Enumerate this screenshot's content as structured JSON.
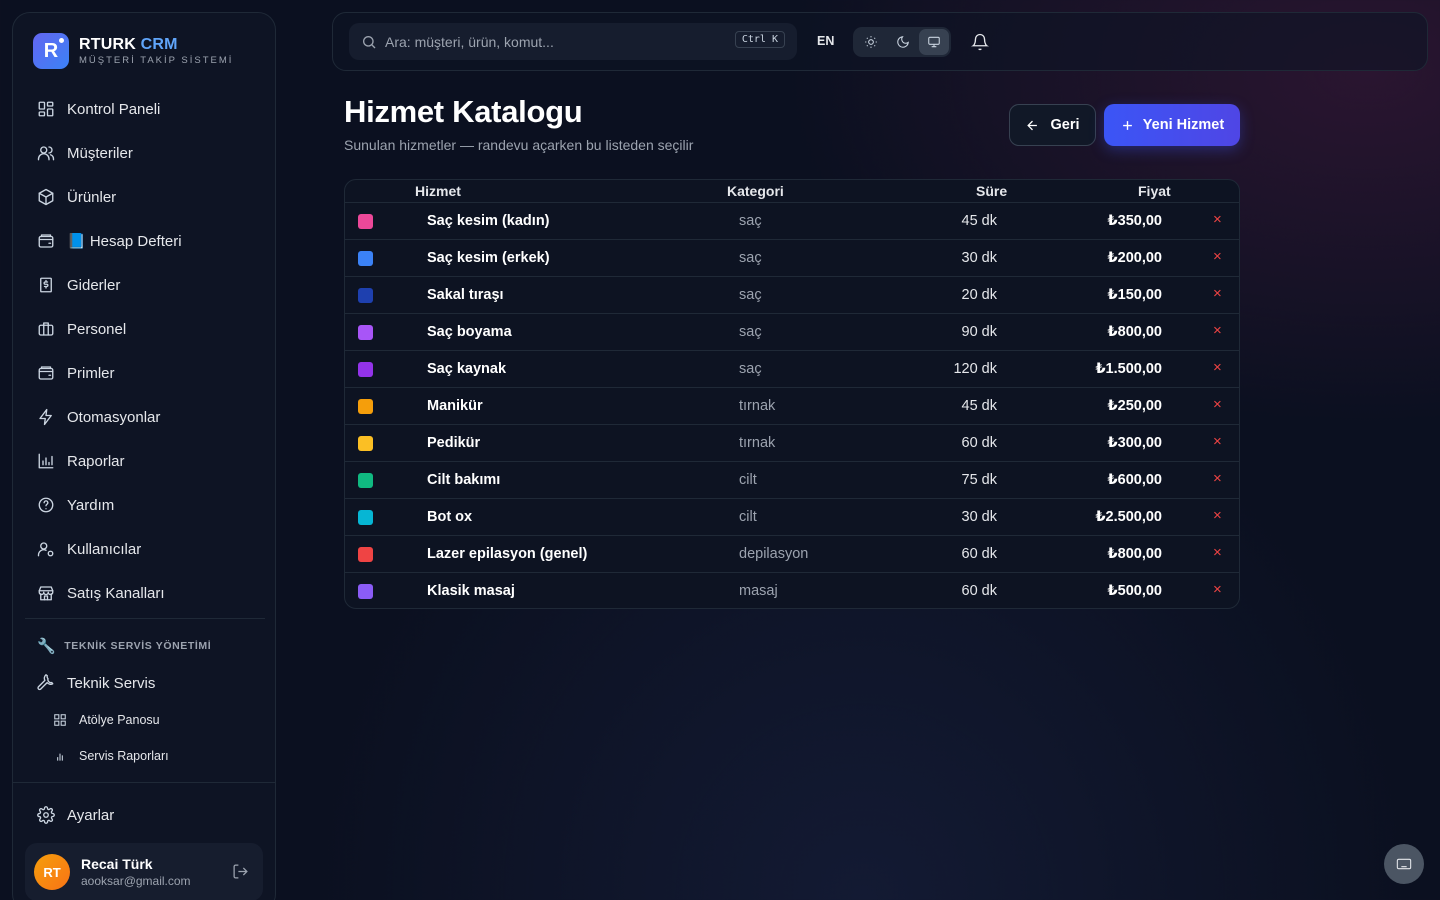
{
  "brand": {
    "name_main": "RTURK",
    "name_accent": "CRM",
    "subtitle": "MÜŞTERİ TAKİP SİSTEMİ",
    "logo_letter": "R"
  },
  "sidebar": {
    "items": [
      {
        "label": "Kontrol Paneli",
        "icon": "dashboard-icon"
      },
      {
        "label": "Müşteriler",
        "icon": "users-icon"
      },
      {
        "label": "Ürünler",
        "icon": "package-icon"
      },
      {
        "label": "📘 Hesap Defteri",
        "icon": "wallet-icon"
      },
      {
        "label": "Giderler",
        "icon": "receipt-icon"
      },
      {
        "label": "Personel",
        "icon": "briefcase-icon"
      },
      {
        "label": "Primler",
        "icon": "wallet-icon"
      },
      {
        "label": "Otomasyonlar",
        "icon": "bolt-icon"
      },
      {
        "label": "Raporlar",
        "icon": "bar-chart-icon"
      },
      {
        "label": "Yardım",
        "icon": "help-circle-icon"
      },
      {
        "label": "Kullanıcılar",
        "icon": "user-cog-icon"
      },
      {
        "label": "Satış Kanalları",
        "icon": "store-icon"
      }
    ],
    "section_title": "TEKNİK SERVİS YÖNETİMİ",
    "service": {
      "label": "Teknik Servis",
      "icon": "wrench-icon"
    },
    "sub_items": [
      {
        "label": "Atölye Panosu",
        "icon": "grid-icon"
      },
      {
        "label": "Servis Raporları",
        "icon": "bar-chart-icon"
      }
    ],
    "settings": {
      "label": "Ayarlar",
      "icon": "gear-icon"
    },
    "user": {
      "initials": "RT",
      "name": "Recai Türk",
      "email": "aooksar@gmail.com"
    }
  },
  "topbar": {
    "search_placeholder": "Ara: müşteri, ürün, komut...",
    "shortcut": "Ctrl K",
    "language": "EN",
    "theme_active": "system"
  },
  "main": {
    "title": "Hizmet Katalogu",
    "subtitle": "Sunulan hizmetler — randevu açarken bu listeden seçilir",
    "back_label": "Geri",
    "new_label": "Yeni Hizmet",
    "table": {
      "headers": {
        "name": "Hizmet",
        "category": "Kategori",
        "duration": "Süre",
        "price": "Fiyat"
      },
      "rows": [
        {
          "color": "#ec4899",
          "name": "Saç kesim (kadın)",
          "category": "saç",
          "duration": "45 dk",
          "price": "₺350,00"
        },
        {
          "color": "#3b82f6",
          "name": "Saç kesim (erkek)",
          "category": "saç",
          "duration": "30 dk",
          "price": "₺200,00"
        },
        {
          "color": "#1e40af",
          "name": "Sakal tıraşı",
          "category": "saç",
          "duration": "20 dk",
          "price": "₺150,00"
        },
        {
          "color": "#a855f7",
          "name": "Saç boyama",
          "category": "saç",
          "duration": "90 dk",
          "price": "₺800,00"
        },
        {
          "color": "#9333ea",
          "name": "Saç kaynak",
          "category": "saç",
          "duration": "120 dk",
          "price": "₺1.500,00"
        },
        {
          "color": "#f59e0b",
          "name": "Manikür",
          "category": "tırnak",
          "duration": "45 dk",
          "price": "₺250,00"
        },
        {
          "color": "#fbbf24",
          "name": "Pedikür",
          "category": "tırnak",
          "duration": "60 dk",
          "price": "₺300,00"
        },
        {
          "color": "#10b981",
          "name": "Cilt bakımı",
          "category": "cilt",
          "duration": "75 dk",
          "price": "₺600,00"
        },
        {
          "color": "#06b6d4",
          "name": "Bot ox",
          "category": "cilt",
          "duration": "30 dk",
          "price": "₺2.500,00"
        },
        {
          "color": "#ef4444",
          "name": "Lazer epilasyon (genel)",
          "category": "depilasyon",
          "duration": "60 dk",
          "price": "₺800,00"
        },
        {
          "color": "#8b5cf6",
          "name": "Klasik masaj",
          "category": "masaj",
          "duration": "60 dk",
          "price": "₺500,00"
        }
      ],
      "delete_symbol": "×"
    }
  }
}
